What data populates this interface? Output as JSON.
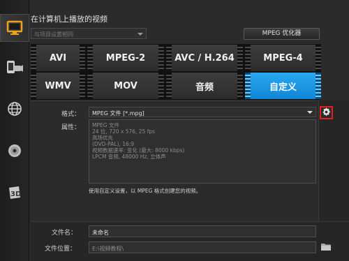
{
  "header": {
    "title": "在计算机上播放的视频"
  },
  "project_combo": {
    "value": "与项目设置相同"
  },
  "optimizer_button": {
    "label": "MPEG 优化器"
  },
  "format_buttons": [
    {
      "label": "AVI",
      "selected": false
    },
    {
      "label": "MPEG-2",
      "selected": false
    },
    {
      "label": "AVC / H.264",
      "selected": false
    },
    {
      "label": "MPEG-4",
      "selected": false
    },
    {
      "label": "WMV",
      "selected": false
    },
    {
      "label": "MOV",
      "selected": false
    },
    {
      "label": "音频",
      "selected": false
    },
    {
      "label": "自定义",
      "selected": true
    }
  ],
  "format": {
    "label": "格式：",
    "value": "MPEG 文件 [*.mpg]"
  },
  "properties": {
    "label": "属性：",
    "lines": [
      "MPEG 文件",
      "24 位, 720 x 576, 25 fps",
      "高场优先",
      "(DVD-PAL), 16:9",
      "视频数据速率: 变化 (最大: 8000 kbps)",
      "LPCM 音频, 48000 Hz, 立体声"
    ]
  },
  "note": "使用自定义设置，以 MPEG 格式创建您的视频。",
  "filename": {
    "label": "文件名：",
    "value": "未命名"
  },
  "location": {
    "label": "文件位置：",
    "value": "E:\\视频教程\\"
  },
  "sidebar_icons": [
    "monitor-icon",
    "device-icon",
    "globe-icon",
    "disc-icon",
    "3d-icon"
  ],
  "colors": {
    "accent": "#1e98e4",
    "highlight": "#e02020",
    "background": "#2b2b2b"
  }
}
